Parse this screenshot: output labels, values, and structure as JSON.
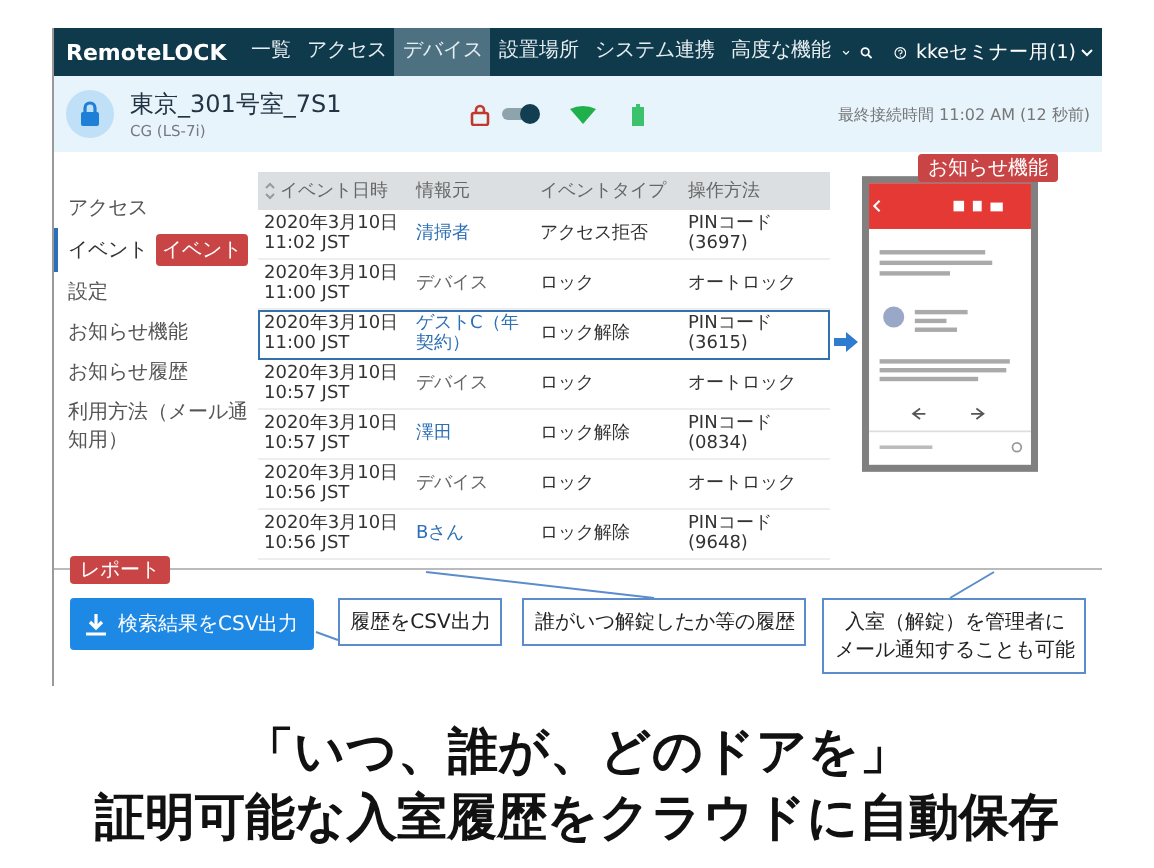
{
  "nav": {
    "logo_main": "Remote",
    "logo_accent": "LOCK",
    "items": [
      {
        "label": "一覧",
        "selected": false
      },
      {
        "label": "アクセス",
        "selected": false
      },
      {
        "label": "デバイス",
        "selected": true
      },
      {
        "label": "設置場所",
        "selected": false
      },
      {
        "label": "システム連携",
        "selected": false
      },
      {
        "label": "高度な機能",
        "selected": false
      }
    ],
    "user": "kkeセミナー用(1)"
  },
  "device": {
    "name": "東京_301号室_7S1",
    "model": "CG (LS-7i)",
    "last_connected": "最終接続時間 11:02 AM (12 秒前)"
  },
  "notice_badge": "お知らせ機能",
  "sidebar": {
    "items": [
      {
        "label": "アクセス",
        "selected": false
      },
      {
        "label": "イベント",
        "selected": true
      },
      {
        "label": "設定",
        "selected": false
      },
      {
        "label": "お知らせ機能",
        "selected": false
      },
      {
        "label": "お知らせ履歴",
        "selected": false
      },
      {
        "label": "利用方法（メール通知用）",
        "selected": false
      }
    ],
    "badge": "イベント"
  },
  "table": {
    "columns": [
      "イベント日時",
      "情報元",
      "イベントタイプ",
      "操作方法"
    ],
    "rows": [
      {
        "date": "2020年3月10日 11:02 JST",
        "source": "清掃者",
        "is_link": true,
        "type": "アクセス拒否",
        "method": "PINコード (3697)",
        "selected": false
      },
      {
        "date": "2020年3月10日 11:00 JST",
        "source": "デバイス",
        "is_link": false,
        "type": "ロック",
        "method": "オートロック",
        "selected": false
      },
      {
        "date": "2020年3月10日 11:00 JST",
        "source": "ゲストC（年契約）",
        "is_link": true,
        "type": "ロック解除",
        "method": "PINコード (3615)",
        "selected": true
      },
      {
        "date": "2020年3月10日 10:57 JST",
        "source": "デバイス",
        "is_link": false,
        "type": "ロック",
        "method": "オートロック",
        "selected": false
      },
      {
        "date": "2020年3月10日 10:57 JST",
        "source": "澤田",
        "is_link": true,
        "type": "ロック解除",
        "method": "PINコード (0834)",
        "selected": false
      },
      {
        "date": "2020年3月10日 10:56 JST",
        "source": "デバイス",
        "is_link": false,
        "type": "ロック",
        "method": "オートロック",
        "selected": false
      },
      {
        "date": "2020年3月10日 10:56 JST",
        "source": "Bさん",
        "is_link": true,
        "type": "ロック解除",
        "method": "PINコード (9648)",
        "selected": false
      }
    ]
  },
  "report_badge": "レポート",
  "export_button": "検索結果をCSV出力",
  "callouts": [
    {
      "lines": [
        "履歴をCSV出力"
      ]
    },
    {
      "lines": [
        "誰がいつ解錠したか等の履歴"
      ]
    },
    {
      "lines": [
        "入室（解錠）を管理者に",
        "メール通知することも可能"
      ]
    }
  ],
  "caption": [
    "「いつ、誰が、どのドアを」",
    "証明可能な入室履歴をクラウドに自動保存"
  ]
}
